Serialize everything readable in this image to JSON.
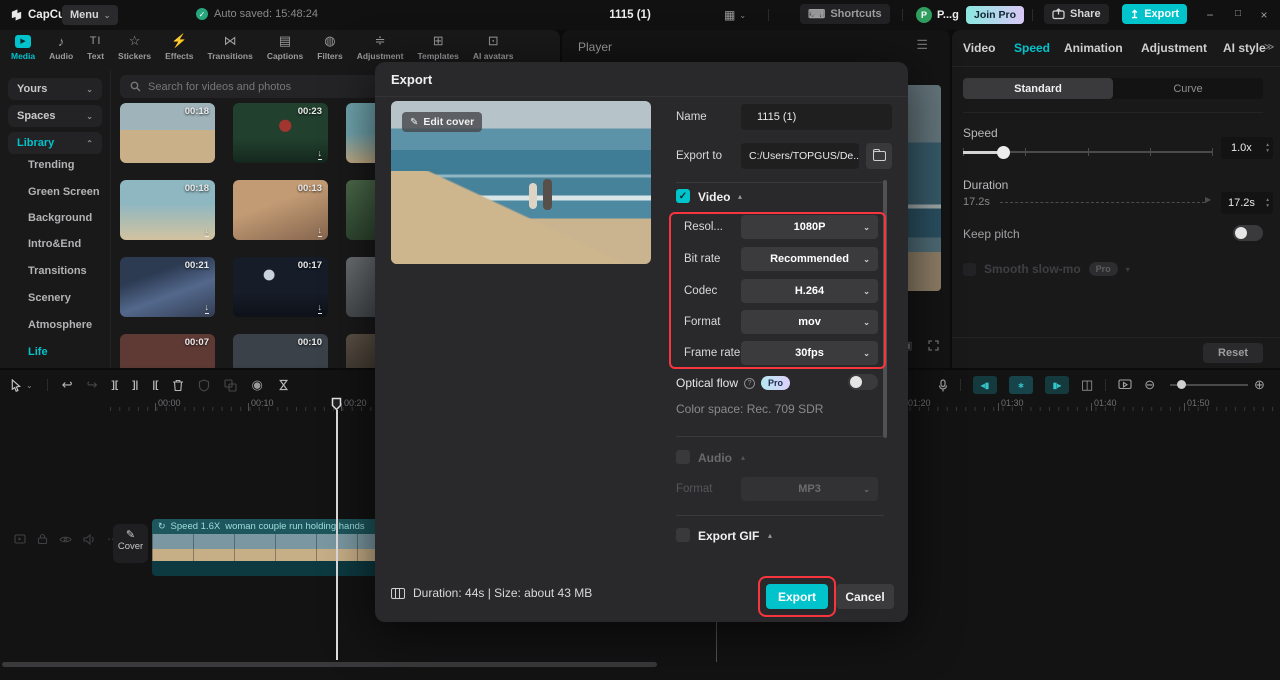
{
  "titlebar": {
    "logo": "CapCut",
    "menu": "Menu",
    "autosave": "Auto saved: 15:48:24",
    "project": "1115 (1)",
    "shortcuts": "Shortcuts",
    "avatar_initial": "P",
    "account": "P...g",
    "join_pro": "Join Pro",
    "share": "Share",
    "export": "Export"
  },
  "toolbar": {
    "items": [
      "Media",
      "Audio",
      "Text",
      "Stickers",
      "Effects",
      "Transitions",
      "Captions",
      "Filters",
      "Adjustment",
      "Templates",
      "AI avatars"
    ]
  },
  "sidebar": {
    "yours": "Yours",
    "spaces": "Spaces",
    "library": "Library",
    "items": [
      "Trending",
      "Green Screen",
      "Background",
      "Intro&End",
      "Transitions",
      "Scenery",
      "Atmosphere",
      "Life"
    ]
  },
  "media": {
    "search_placeholder": "Search for videos and photos",
    "thumbs": [
      "00:18",
      "00:23",
      "",
      "00:18",
      "00:13",
      "",
      "00:21",
      "00:17",
      "",
      "00:07",
      "00:10",
      ""
    ]
  },
  "player": {
    "title": "Player"
  },
  "speed_panel": {
    "tabs": [
      "Video",
      "Speed",
      "Animation",
      "Adjustment",
      "AI style"
    ],
    "standard": "Standard",
    "curve": "Curve",
    "speed_label": "Speed",
    "speed_value": "1.0x",
    "duration_label": "Duration",
    "duration_min": "17.2s",
    "duration_value": "17.2s",
    "keep_pitch": "Keep pitch",
    "smooth": "Smooth slow-mo",
    "pro": "Pro",
    "reset": "Reset"
  },
  "dialog": {
    "title": "Export",
    "edit_cover": "Edit cover",
    "name_label": "Name",
    "name_value": "1115 (1)",
    "export_to_label": "Export to",
    "export_to_value": "C:/Users/TOPGUS/De...",
    "video": "Video",
    "rows": [
      {
        "label": "Resol...",
        "value": "1080P"
      },
      {
        "label": "Bit rate",
        "value": "Recommended"
      },
      {
        "label": "Codec",
        "value": "H.264"
      },
      {
        "label": "Format",
        "value": "mov"
      },
      {
        "label": "Frame rate",
        "value": "30fps"
      }
    ],
    "optical_flow": "Optical flow",
    "pro": "Pro",
    "color_space": "Color space: Rec. 709 SDR",
    "audio": "Audio",
    "audio_format_label": "Format",
    "audio_format_value": "MP3",
    "export_gif": "Export GIF",
    "summary": "Duration: 44s | Size: about 43 MB",
    "export": "Export",
    "cancel": "Cancel"
  },
  "timeline": {
    "ruler": [
      "00:00",
      "00:10",
      "00:20",
      "01:20",
      "01:30",
      "01:40",
      "01:50"
    ],
    "cover": "Cover",
    "clip_speed": "Speed 1.6X",
    "clip_name": "woman couple run holding hands"
  },
  "colors": {
    "accent": "#00c3cc",
    "highlight_red": "#f8353f",
    "avatar_green": "#2f9e5f",
    "pro_badge_from": "#b5e7f2",
    "pro_badge_to": "#ddd0fa"
  }
}
